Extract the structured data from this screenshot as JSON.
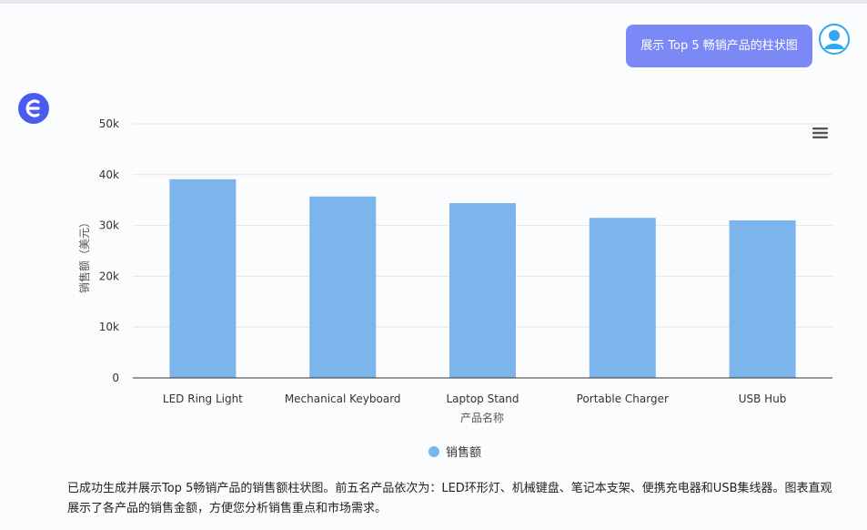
{
  "user_message": "展示 Top 5 畅销产品的柱状图",
  "assistant_message": "已成功生成并展示Top 5畅销产品的销售额柱状图。前五名产品依次为：LED环形灯、机械键盘、笔记本支架、便携充电器和USB集线器。图表直观展示了各产品的销售金额，方便您分析销售重点和市场需求。",
  "icons": {
    "user_avatar": "user-avatar-icon",
    "bot_avatar": "assistant-logo-icon",
    "chart_menu": "hamburger-menu-icon"
  },
  "colors": {
    "user_bubble": "#7b89f7",
    "bar": "#7cb5ec",
    "bot_logo": "#4a5cf0",
    "user_avatar": "#2ea8ef"
  },
  "chart_data": {
    "type": "bar",
    "categories": [
      "LED Ring Light",
      "Mechanical Keyboard",
      "Laptop Stand",
      "Portable Charger",
      "USB Hub"
    ],
    "series": [
      {
        "name": "销售额",
        "values": [
          39100,
          35700,
          34400,
          31500,
          31000
        ]
      }
    ],
    "title": "",
    "xlabel": "产品名称",
    "ylabel": "销售额（美元）",
    "ylim": [
      0,
      50000
    ],
    "yticks": [
      0,
      10000,
      20000,
      30000,
      40000,
      50000
    ],
    "ytick_labels": [
      "0",
      "10k",
      "20k",
      "30k",
      "40k",
      "50k"
    ],
    "grid": true,
    "legend": "bottom-center"
  }
}
